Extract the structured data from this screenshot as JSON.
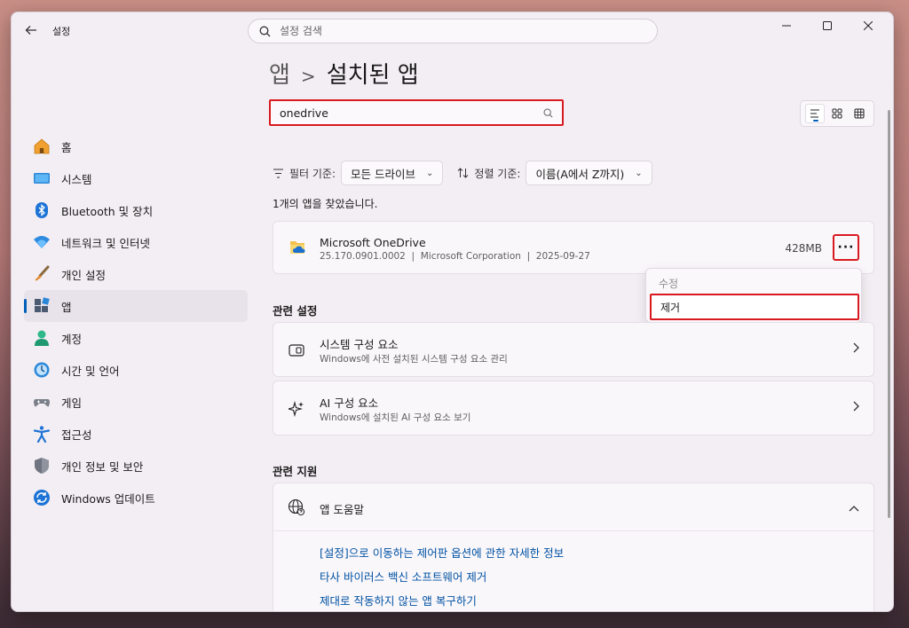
{
  "window": {
    "app_title": "설정",
    "search_placeholder": "설정 검색"
  },
  "sidebar": {
    "items": [
      {
        "label": "홈",
        "icon": "home-icon"
      },
      {
        "label": "시스템",
        "icon": "system-icon"
      },
      {
        "label": "Bluetooth 및 장치",
        "icon": "bluetooth-icon"
      },
      {
        "label": "네트워크 및 인터넷",
        "icon": "wifi-icon"
      },
      {
        "label": "개인 설정",
        "icon": "brush-icon"
      },
      {
        "label": "앱",
        "icon": "apps-icon",
        "active": true
      },
      {
        "label": "계정",
        "icon": "account-icon"
      },
      {
        "label": "시간 및 언어",
        "icon": "time-language-icon"
      },
      {
        "label": "게임",
        "icon": "gamepad-icon"
      },
      {
        "label": "접근성",
        "icon": "accessibility-icon"
      },
      {
        "label": "개인 정보 및 보안",
        "icon": "shield-icon"
      },
      {
        "label": "Windows 업데이트",
        "icon": "update-icon"
      }
    ]
  },
  "main": {
    "breadcrumb": {
      "parent": "앱",
      "separator": ">",
      "current": "설치된 앱"
    },
    "app_search_value": "onedrive",
    "filter": {
      "filter_label": "필터 기준:",
      "filter_value": "모든 드라이브",
      "sort_label": "정렬 기준:",
      "sort_value": "이름(A에서 Z까지)"
    },
    "found_text": "1개의 앱을 찾았습니다.",
    "app": {
      "name": "Microsoft OneDrive",
      "meta": "25.170.0901.0002  |  Microsoft Corporation  |  2025-09-27",
      "size": "428MB",
      "more_label": "···"
    },
    "context_menu": {
      "modify": "수정",
      "uninstall": "제거"
    },
    "related_settings": {
      "title": "관련 설정",
      "items": [
        {
          "title": "시스템 구성 요소",
          "subtitle": "Windows에 사전 설치된 시스템 구성 요소 관리",
          "icon": "component-icon"
        },
        {
          "title": "AI 구성 요소",
          "subtitle": "Windows에 설치된 AI 구성 요소 보기",
          "icon": "sparkle-icon"
        }
      ]
    },
    "related_support": {
      "title": "관련 지원",
      "help_title": "앱 도움말",
      "links": [
        "[설정]으로 이동하는 제어판 옵션에 관한 자세한 정보",
        "타사 바이러스 백신 소프트웨어 제거",
        "제대로 작동하지 않는 앱 복구하기"
      ]
    }
  },
  "colors": {
    "accent": "#005fb8",
    "highlight_red": "#d8191f",
    "link": "#0052a3"
  }
}
